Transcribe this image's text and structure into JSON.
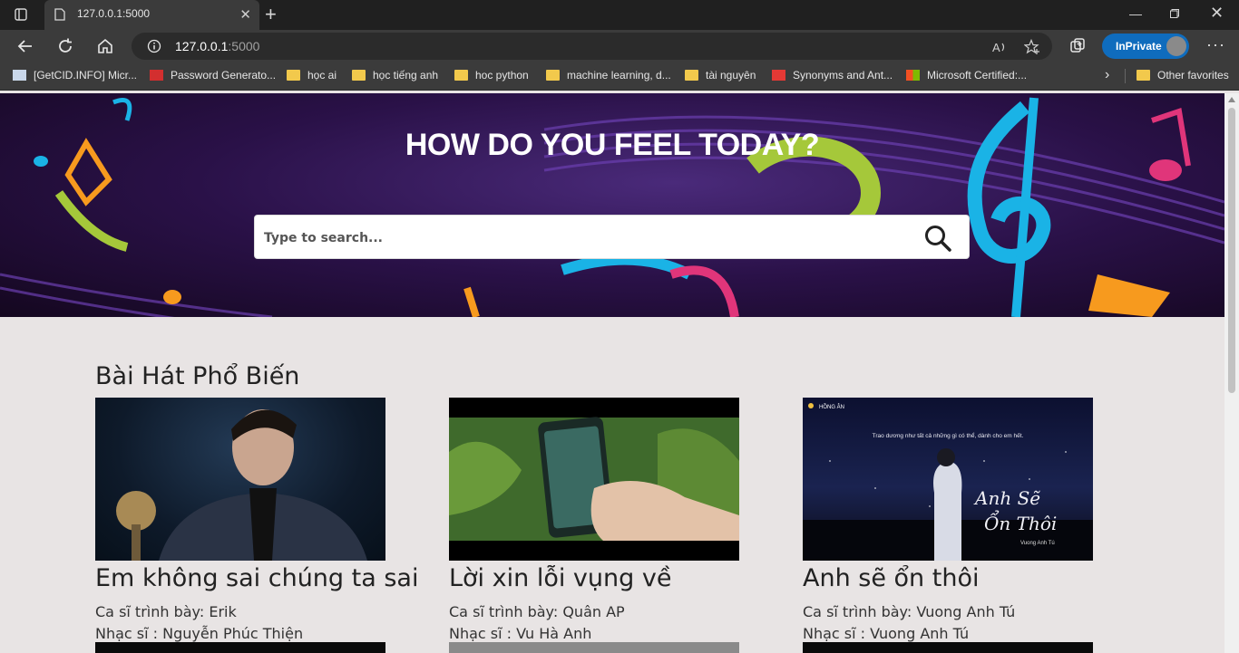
{
  "browser": {
    "tab_title": "127.0.0.1:5000",
    "url_host": "127.0.0.1",
    "url_port": ":5000",
    "inprivate_label": "InPrivate",
    "bookmarks": [
      "[GetCID.INFO] Micr...",
      "Password Generato...",
      "học ai",
      "học tiếng anh",
      "hoc python",
      "machine learning, d...",
      "tài nguyên",
      "Synonyms and Ant...",
      "Microsoft Certified:..."
    ],
    "other_favorites": "Other favorites"
  },
  "hero": {
    "title": "HOW DO YOU FEEL TODAY?",
    "search_placeholder": "Type to search..."
  },
  "section": {
    "title": "Bài Hát Phổ Biến"
  },
  "songs": [
    {
      "title": "Em không sai chúng ta sai",
      "singer": "Ca sĩ trình bày: Erik",
      "composer": "Nhạc sĩ : Nguyễn Phúc Thiện"
    },
    {
      "title": "Lời xin lỗi vụng về",
      "singer": "Ca sĩ trình bày: Quân AP",
      "composer": "Nhạc sĩ : Vu Hà Anh"
    },
    {
      "title": "Anh sẽ ổn thôi",
      "singer": "Ca sĩ trình bày: Vuong Anh Tú",
      "composer": "Nhạc sĩ : Vuong Anh Tú",
      "thumb_caption": "Trao dương như tất cả những gì có thể, dành cho em hết.",
      "thumb_channel": "HỒNG ÂN",
      "thumb_script_1": "Anh Sẽ",
      "thumb_script_2": "Ổn Thôi",
      "thumb_artist": "Vuong Anh Tú"
    }
  ],
  "colors": {
    "page_bg": "#e8e4e4",
    "chrome_dark": "#202020",
    "chrome": "#3b3b3b",
    "accent": "#0f6cbd"
  }
}
